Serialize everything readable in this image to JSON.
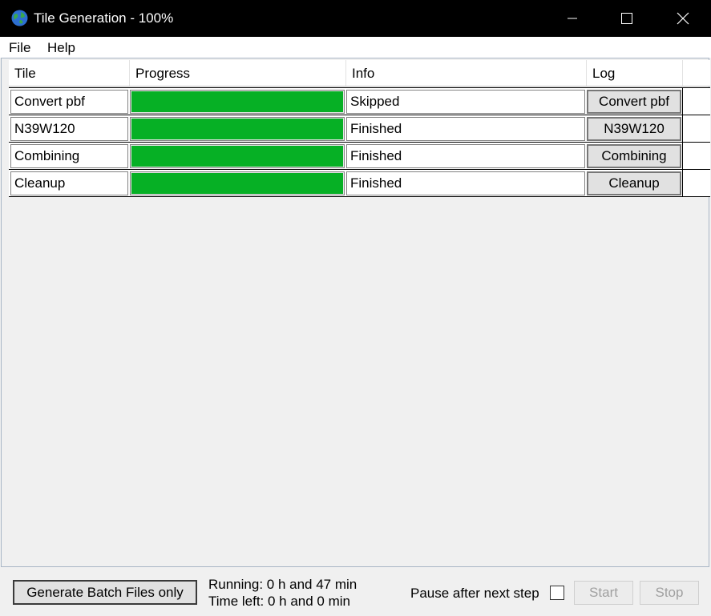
{
  "window": {
    "title": "Tile Generation - 100%",
    "app_icon": "globe-icon",
    "controls": [
      "minimize-icon",
      "maximize-icon",
      "close-icon"
    ]
  },
  "menu": {
    "items": [
      {
        "label": "File"
      },
      {
        "label": "Help"
      }
    ]
  },
  "table": {
    "headers": [
      "Tile",
      "Progress",
      "Info",
      "Log"
    ],
    "rows": [
      {
        "tile": "Convert pbf",
        "progress": 1.0,
        "info": "Skipped",
        "log": "Convert pbf"
      },
      {
        "tile": "N39W120",
        "progress": 1.0,
        "info": "Finished",
        "log": "N39W120"
      },
      {
        "tile": "Combining",
        "progress": 1.0,
        "info": "Finished",
        "log": "Combining"
      },
      {
        "tile": "Cleanup",
        "progress": 1.0,
        "info": "Finished",
        "log": "Cleanup"
      }
    ]
  },
  "footer": {
    "generate_label": "Generate Batch Files only",
    "running": "Running: 0 h and 47 min",
    "time_left": "Time left: 0 h and 0 min",
    "pause_label": "Pause after next step",
    "pause_checked": false,
    "start_label": "Start",
    "stop_label": "Stop"
  },
  "colors": {
    "progress_fill": "#06b025",
    "titlebar": "#000000"
  }
}
